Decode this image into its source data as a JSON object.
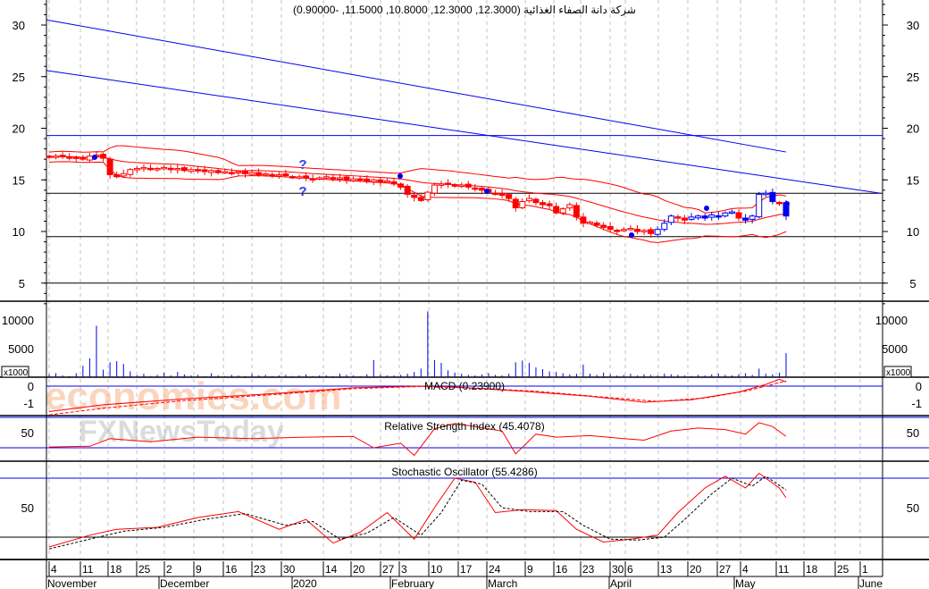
{
  "chart_data": {
    "type": "candlestick",
    "title": "شركة دانة الصفاء الغذائية (12.3000, 12.3000, 10.8000, 11.5000, -0.90000)",
    "price_axis": {
      "ylim": [
        2.3,
        32.3
      ],
      "ticks": [
        5,
        10,
        15,
        20,
        25,
        30
      ]
    },
    "closes": [
      17.2,
      17.3,
      17.3,
      17.2,
      17.1,
      17.0,
      17.3,
      17.4,
      17.1,
      15.5,
      15.3,
      15.6,
      16.0,
      16.1,
      16.2,
      16.0,
      16.1,
      16.2,
      16.0,
      16.1,
      15.9,
      16.0,
      15.9,
      15.8,
      15.9,
      15.7,
      15.8,
      15.7,
      15.8,
      15.6,
      15.7,
      15.5,
      15.6,
      15.5,
      15.5,
      15.4,
      15.3,
      15.3,
      15.2,
      15.1,
      15.2,
      15.3,
      15.1,
      15.2,
      15.0,
      15.1,
      15.0,
      14.9,
      15.0,
      14.8,
      14.9,
      14.6,
      14.3,
      13.6,
      13.3,
      13.0,
      13.8,
      14.5,
      14.6,
      14.6,
      14.4,
      14.5,
      14.3,
      14.2,
      14.0,
      13.8,
      13.7,
      13.5,
      13.2,
      12.3,
      12.9,
      13.2,
      12.8,
      12.6,
      12.5,
      11.8,
      12.2,
      12.6,
      11.4,
      10.8,
      10.9,
      10.6,
      10.4,
      10.2,
      10.1,
      10.2,
      10.3,
      10.0,
      10.1,
      9.8,
      10.2,
      10.8,
      11.5,
      11.3,
      11.1,
      11.4,
      11.5,
      11.3,
      11.6,
      11.5,
      11.8,
      11.9,
      11.3,
      11.1,
      11.5,
      13.6,
      13.7,
      12.9,
      12.8,
      11.5
    ],
    "horizontal_lines": [
      {
        "value": 19.3,
        "color": "#0000ee"
      },
      {
        "value": 13.7,
        "color": "#000000"
      },
      {
        "value": 9.5,
        "color": "#000000"
      },
      {
        "value": 5,
        "color": "#000000"
      }
    ],
    "trendlines": [
      {
        "start": 30.5,
        "end": 17.7,
        "end_index": 109,
        "color": "#0000ee"
      },
      {
        "start": 25.6,
        "end": 13.7,
        "end_index": 123,
        "color": "#0000ee"
      }
    ],
    "bollinger": {
      "period": 20,
      "stdev": 2,
      "color": "#ff0000"
    },
    "volume": {
      "multiplier_label": "x1000",
      "ticks": [
        5000,
        10000
      ],
      "values": [
        500,
        700,
        300,
        200,
        700,
        2000,
        3300,
        9000,
        1300,
        2600,
        2800,
        2300,
        1000,
        300,
        600,
        200,
        400,
        800,
        300,
        900,
        500,
        300,
        400,
        200,
        700,
        300,
        200,
        400,
        300,
        200,
        600,
        300,
        400,
        200,
        300,
        400,
        200,
        300,
        500,
        200,
        300,
        300,
        200,
        600,
        400,
        300,
        200,
        500,
        3000,
        400,
        300,
        300,
        400,
        600,
        900,
        1500,
        11500,
        3000,
        2500,
        1200,
        800,
        600,
        400,
        300,
        500,
        700,
        400,
        300,
        600,
        2600,
        2900,
        2500,
        1700,
        1400,
        1000,
        900,
        700,
        500,
        600,
        2200,
        600,
        400,
        800,
        500,
        300,
        400,
        600,
        300,
        500,
        400,
        300,
        600,
        500,
        400,
        300,
        200,
        400,
        300,
        500,
        600,
        400,
        300,
        500,
        700,
        400,
        1500,
        600,
        500,
        800,
        4200
      ]
    },
    "macd": {
      "label": "MACD (0.23900)",
      "ticks": [
        "0",
        "-1"
      ],
      "macd": [
        [
          0,
          -1.5
        ],
        [
          8,
          -1.1
        ],
        [
          20,
          -0.75
        ],
        [
          33,
          -0.45
        ],
        [
          45,
          -0.1
        ],
        [
          55,
          0.0
        ],
        [
          60,
          -0.05
        ],
        [
          70,
          -0.3
        ],
        [
          80,
          -0.6
        ],
        [
          88,
          -0.95
        ],
        [
          95,
          -0.8
        ],
        [
          102,
          -0.35
        ],
        [
          106,
          0.1
        ],
        [
          108,
          0.4
        ],
        [
          109,
          0.25
        ]
      ],
      "signal": [
        [
          0,
          -1.7
        ],
        [
          8,
          -1.3
        ],
        [
          20,
          -0.85
        ],
        [
          33,
          -0.5
        ],
        [
          45,
          -0.15
        ],
        [
          55,
          -0.02
        ],
        [
          62,
          -0.1
        ],
        [
          72,
          -0.3
        ],
        [
          82,
          -0.65
        ],
        [
          90,
          -0.9
        ],
        [
          97,
          -0.7
        ],
        [
          103,
          -0.3
        ],
        [
          107,
          0.1
        ],
        [
          109,
          0.3
        ]
      ]
    },
    "rsi": {
      "label": "Relative Strength Index (45.4078)",
      "tick": "50",
      "levels": [
        70,
        30
      ],
      "values": [
        [
          0,
          31
        ],
        [
          6,
          32
        ],
        [
          9,
          42
        ],
        [
          15,
          38
        ],
        [
          22,
          44
        ],
        [
          30,
          42
        ],
        [
          38,
          44
        ],
        [
          45,
          45
        ],
        [
          48,
          30
        ],
        [
          52,
          36
        ],
        [
          54,
          20
        ],
        [
          57,
          55
        ],
        [
          60,
          62
        ],
        [
          63,
          58
        ],
        [
          67,
          52
        ],
        [
          69,
          22
        ],
        [
          72,
          48
        ],
        [
          75,
          44
        ],
        [
          80,
          46
        ],
        [
          85,
          42
        ],
        [
          88,
          40
        ],
        [
          92,
          52
        ],
        [
          96,
          56
        ],
        [
          100,
          54
        ],
        [
          103,
          48
        ],
        [
          105,
          63
        ],
        [
          107,
          58
        ],
        [
          109,
          45
        ]
      ]
    },
    "stochastic": {
      "label": "Stochastic Oscillator (55.4286)",
      "tick": "50",
      "levels": [
        80,
        20
      ],
      "k": [
        [
          0,
          10
        ],
        [
          6,
          22
        ],
        [
          10,
          28
        ],
        [
          16,
          30
        ],
        [
          22,
          40
        ],
        [
          28,
          46
        ],
        [
          34,
          28
        ],
        [
          38,
          38
        ],
        [
          42,
          14
        ],
        [
          46,
          25
        ],
        [
          50,
          45
        ],
        [
          54,
          18
        ],
        [
          57,
          50
        ],
        [
          60,
          80
        ],
        [
          63,
          76
        ],
        [
          66,
          45
        ],
        [
          70,
          48
        ],
        [
          75,
          47
        ],
        [
          78,
          28
        ],
        [
          82,
          15
        ],
        [
          86,
          18
        ],
        [
          90,
          22
        ],
        [
          93,
          45
        ],
        [
          97,
          70
        ],
        [
          100,
          82
        ],
        [
          103,
          70
        ],
        [
          105,
          85
        ],
        [
          108,
          70
        ],
        [
          109,
          60
        ]
      ],
      "d": [
        [
          0,
          8
        ],
        [
          6,
          18
        ],
        [
          11,
          26
        ],
        [
          17,
          30
        ],
        [
          23,
          38
        ],
        [
          29,
          44
        ],
        [
          35,
          32
        ],
        [
          39,
          36
        ],
        [
          43,
          18
        ],
        [
          47,
          24
        ],
        [
          51,
          40
        ],
        [
          55,
          22
        ],
        [
          58,
          45
        ],
        [
          61,
          78
        ],
        [
          64,
          74
        ],
        [
          67,
          50
        ],
        [
          71,
          46
        ],
        [
          76,
          46
        ],
        [
          79,
          32
        ],
        [
          83,
          18
        ],
        [
          87,
          17
        ],
        [
          91,
          20
        ],
        [
          94,
          38
        ],
        [
          98,
          64
        ],
        [
          101,
          80
        ],
        [
          104,
          72
        ],
        [
          106,
          82
        ],
        [
          109,
          68
        ]
      ]
    },
    "x_axis": {
      "days": [
        "4",
        "11",
        "18",
        "25",
        "2",
        "9",
        "16",
        "23",
        "30",
        "14",
        "20",
        "27",
        "3",
        "10",
        "17",
        "24",
        "9",
        "16",
        "23",
        "30",
        "6",
        "13",
        "20",
        "27",
        "4",
        "11",
        "18",
        "25",
        "1"
      ],
      "months": [
        "November",
        "December",
        "2020",
        "February",
        "March",
        "April",
        "May",
        "June"
      ]
    },
    "watermark": {
      "line1": "economies.com",
      "line2": "FXNewsToday"
    },
    "colors": {
      "down": "#ff0000",
      "up_early": "#ff0000",
      "up_late": "#0000ee",
      "volume": "#0000ee",
      "grid": "#c0c0c0"
    }
  }
}
